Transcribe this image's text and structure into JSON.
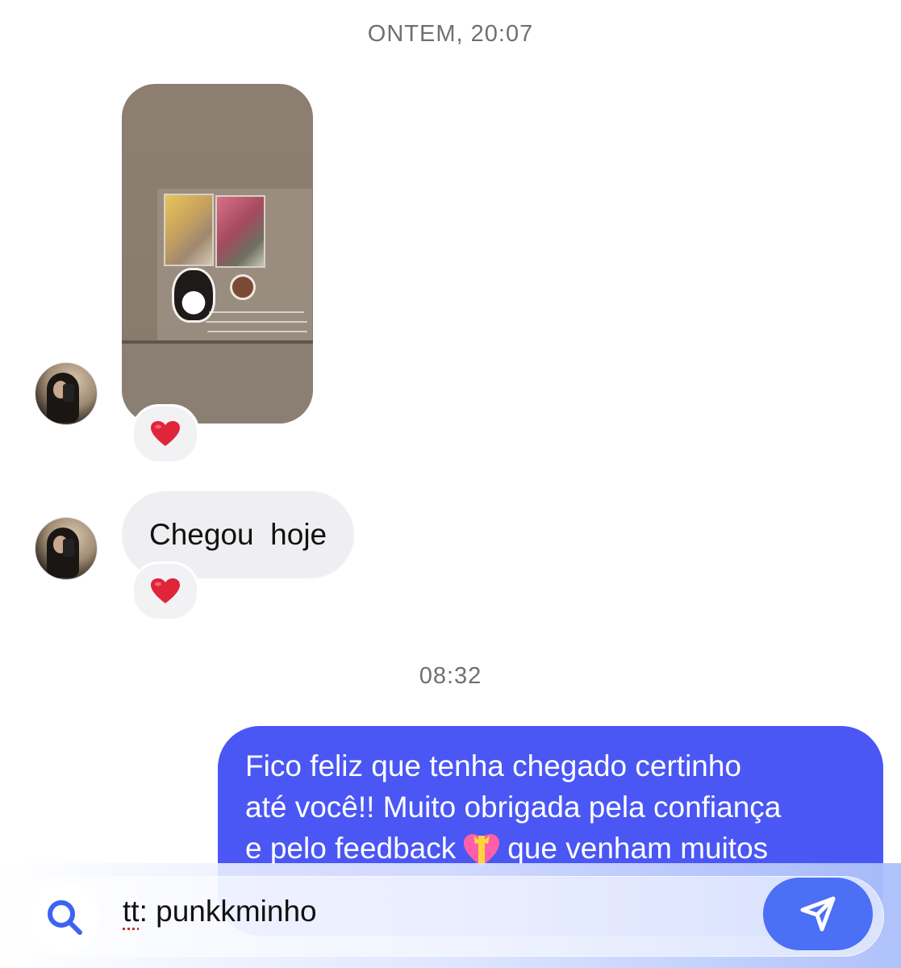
{
  "timestamps": {
    "first": "ONTEM, 20:07",
    "second": "08:32"
  },
  "messages": {
    "incoming_photo": {
      "reaction": "❤️"
    },
    "incoming_text": {
      "text": "Chegou  hoje",
      "reaction": "❤️"
    },
    "outgoing": {
      "lines": [
        "Fico feliz que tenha chegado certinho",
        "até você!! Muito obrigada pela confiança"
      ],
      "line3_before": "e pelo feedback",
      "line3_after": "que venham muitos"
    }
  },
  "search": {
    "value_prefix": "tt",
    "value_rest": ": punkkminho"
  },
  "colors": {
    "outgoing_bubble": "#4a57f5",
    "incoming_bubble": "#efeff2",
    "send_button": "#4b6ff5",
    "search_icon": "#3d63f2"
  },
  "icons": {
    "search": "search-icon",
    "send": "send-icon",
    "heart": "heart-reaction-icon",
    "gift_heart": "heart-with-ribbon-emoji"
  }
}
